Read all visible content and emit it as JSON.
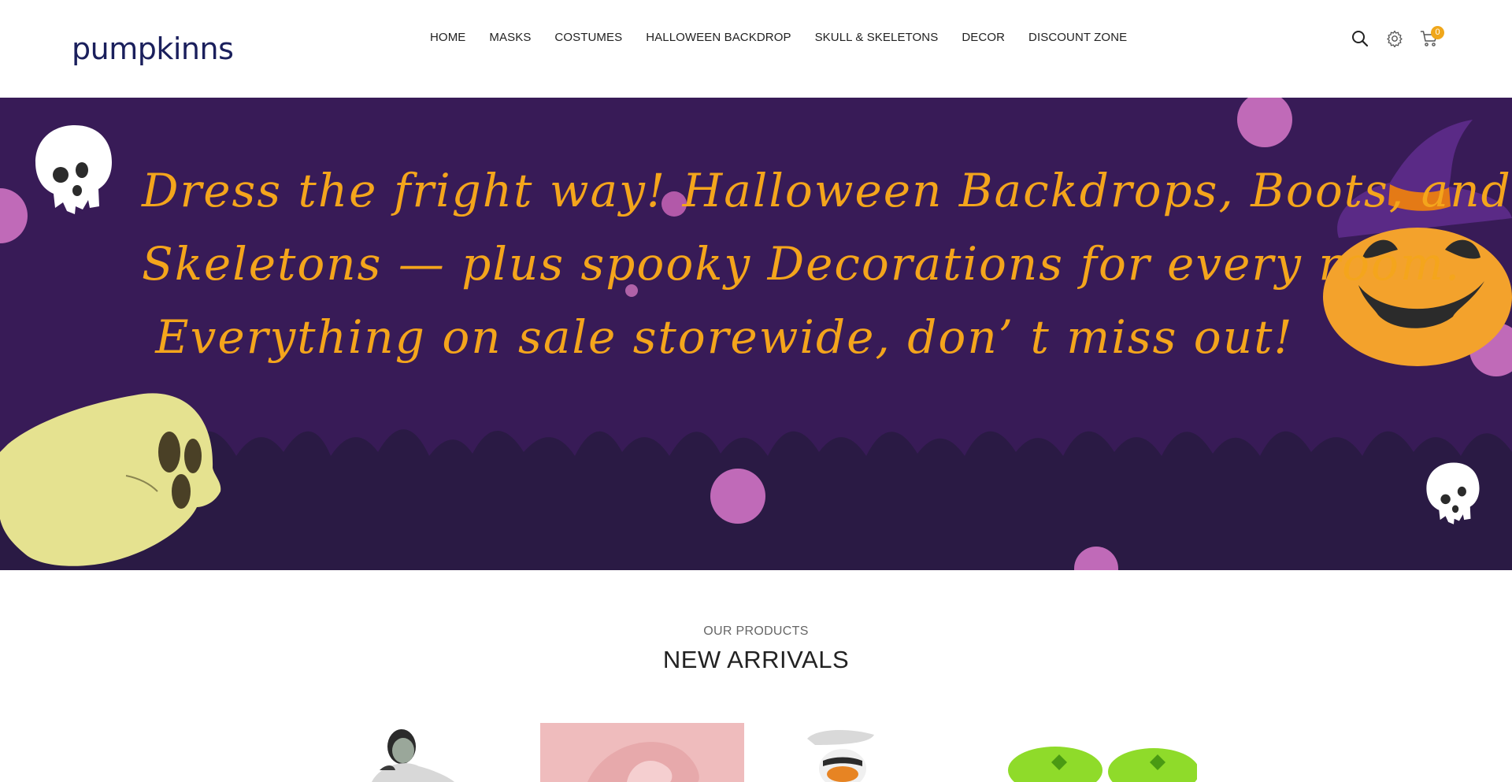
{
  "header": {
    "logo": "pumpkinns",
    "nav": [
      "HOME",
      "MASKS",
      "COSTUMES",
      "HALLOWEEN BACKDROP",
      "SKULL & SKELETONS",
      "DECOR",
      "DISCOUNT ZONE"
    ],
    "cart_count": "0"
  },
  "icons": {
    "search": "search-icon",
    "settings": "gear-icon",
    "cart": "cart-icon"
  },
  "hero": {
    "lines": [
      "Dress the fright way! Halloween Backdrops, Boots, and",
      "Skeletons — plus spooky Decorations for every room.",
      "Everything on sale storewide, don’ t miss out!"
    ],
    "text_color": "#f4a51c",
    "background": "#381b57"
  },
  "products": {
    "subtitle": "OUR PRODUCTS",
    "title": "NEW ARRIVALS"
  },
  "colors": {
    "accent": "#f0a71b",
    "logo": "#1a1f5c"
  }
}
